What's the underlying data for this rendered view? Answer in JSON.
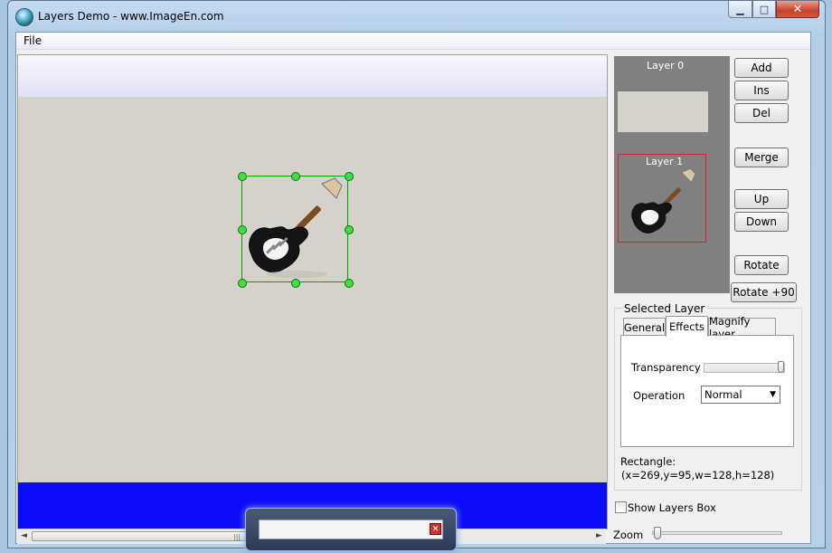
{
  "window": {
    "title": "Layers Demo  - www.ImageEn.com",
    "minimize_glyph": "▁",
    "maximize_glyph": "□",
    "close_glyph": "✕"
  },
  "menu": {
    "file_label": "File"
  },
  "layers_box": {
    "layer0_label": "Layer 0",
    "layer1_label": "Layer 1"
  },
  "buttons": {
    "add": "Add",
    "ins": "Ins",
    "del": "Del",
    "merge": "Merge",
    "up": "Up",
    "down": "Down",
    "rotate": "Rotate",
    "rotate90": "Rotate +90"
  },
  "selected_layer": {
    "group_title": "Selected Layer",
    "tabs": [
      {
        "label": "General",
        "active": false
      },
      {
        "label": "Effects",
        "active": true
      },
      {
        "label": "Magnify layer",
        "active": false
      }
    ],
    "transparency_label": "Transparency",
    "transparency_value": 1.0,
    "operation_label": "Operation",
    "operation_value": "Normal",
    "rect_label": "Rectangle:",
    "rect_value": "(x=269,y=95,w=128,h=128)"
  },
  "show_layers_box": {
    "label": "Show Layers Box",
    "checked": false
  },
  "zoom": {
    "label": "Zoom",
    "value": 0.0
  },
  "scrollbar": {
    "left_arrow": "◄",
    "right_arrow": "►",
    "grip": "|||"
  },
  "colors": {
    "canvas_bg": "#d4d2cb",
    "blue_band": "#0b0bf7",
    "selection": "#00a000",
    "handle": "#3fe03f",
    "layer_highlight": "#e02020"
  }
}
